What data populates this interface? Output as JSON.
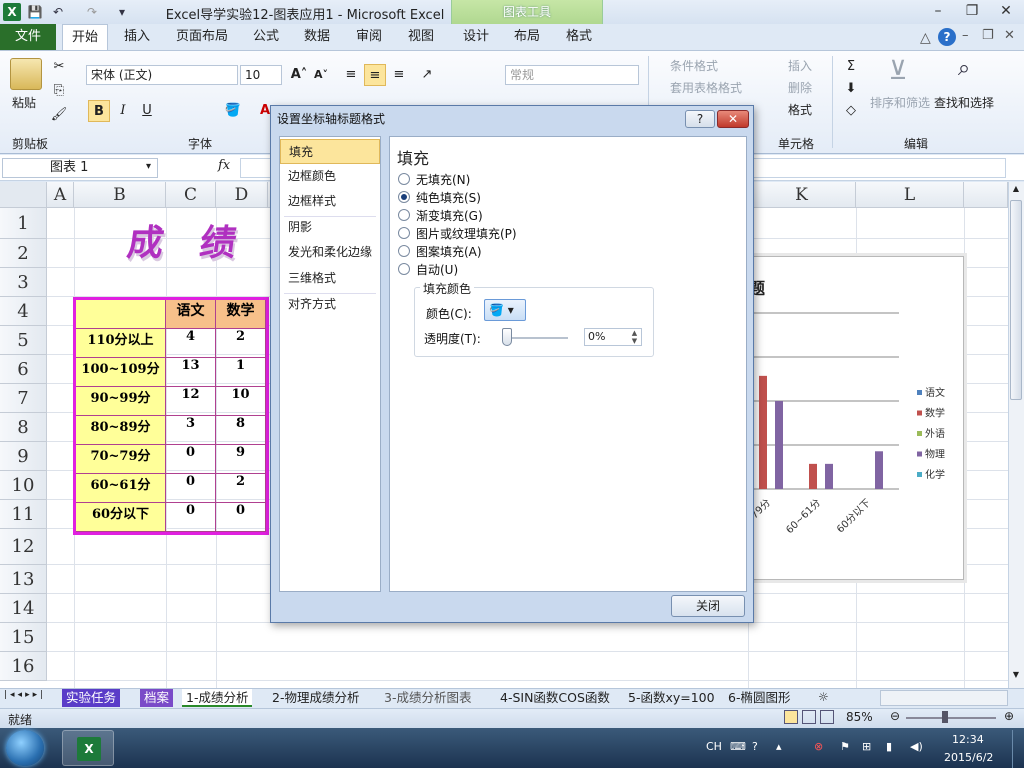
{
  "window": {
    "title": "Excel导学实验12-图表应用1 - Microsoft Excel",
    "context_tab_title": "图表工具"
  },
  "tabs": {
    "file": "文件",
    "home": "开始",
    "insert": "插入",
    "page_layout": "页面布局",
    "formulas": "公式",
    "data": "数据",
    "review": "审阅",
    "view": "视图",
    "design": "设计",
    "layout": "布局",
    "format": "格式"
  },
  "ribbon": {
    "paste": "粘贴",
    "font_name": "宋体 (正文)",
    "font_size": "10",
    "number_format": "常规",
    "conditional_format": "条件格式",
    "table_format": "套用表格格式",
    "insert": "插入",
    "delete": "删除",
    "format": "格式",
    "sort_filter": "排序和筛选",
    "find_select": "查找和选择",
    "groups": {
      "clipboard": "剪贴板",
      "font": "字体",
      "cells": "单元格",
      "editing": "编辑"
    }
  },
  "formula_bar": {
    "name_box": "图表 1",
    "fx": "fx"
  },
  "sheet": {
    "columns": [
      "A",
      "B",
      "C",
      "D",
      "K",
      "L"
    ],
    "rows": [
      "1",
      "2",
      "3",
      "4",
      "5",
      "6",
      "7",
      "8",
      "9",
      "10",
      "11",
      "12",
      "13",
      "14",
      "15",
      "16"
    ],
    "title_art": "成 绩 分",
    "table": {
      "headers": [
        "语文",
        "数学"
      ],
      "rows": [
        {
          "label": "110分以上",
          "v1": "4",
          "v2": "2"
        },
        {
          "label": "100~109分",
          "v1": "13",
          "v2": "1"
        },
        {
          "label": "90~99分",
          "v1": "12",
          "v2": "10"
        },
        {
          "label": "80~89分",
          "v1": "3",
          "v2": "8"
        },
        {
          "label": "70~79分",
          "v1": "0",
          "v2": "9"
        },
        {
          "label": "60~61分",
          "v1": "0",
          "v2": "2"
        },
        {
          "label": "60分以下",
          "v1": "0",
          "v2": "0"
        }
      ]
    }
  },
  "chart_data": {
    "type": "bar",
    "title": "题",
    "legend": [
      "语文",
      "数学",
      "外语",
      "物理",
      "化学"
    ],
    "legend_colors": [
      "#4f81bd",
      "#c0504d",
      "#9bbb59",
      "#8064a2",
      "#4bacc6"
    ],
    "categories": [
      "79分",
      "60~61分",
      "60分以下"
    ],
    "series": [
      {
        "name": "数学",
        "values": [
          9,
          2,
          0
        ]
      },
      {
        "name": "物理",
        "values": [
          7,
          2,
          3
        ]
      }
    ]
  },
  "dialog": {
    "title": "设置坐标轴标题格式",
    "help": "?",
    "close_glyph": "✕",
    "nav": [
      "填充",
      "边框颜色",
      "边框样式",
      "阴影",
      "发光和柔化边缘",
      "三维格式",
      "对齐方式"
    ],
    "panel_title": "填充",
    "options": [
      "无填充(N)",
      "纯色填充(S)",
      "渐变填充(G)",
      "图片或纹理填充(P)",
      "图案填充(A)",
      "自动(U)"
    ],
    "selected": "纯色填充(S)",
    "fill_group": "填充颜色",
    "color_label": "颜色(C):",
    "transparency_label": "透明度(T):",
    "transparency_value": "0%",
    "close_button": "关闭"
  },
  "sheet_tabs": [
    "实验任务",
    "档案",
    "1-成绩分析",
    "2-物理成绩分析",
    "3-成绩分析图表",
    "4-SIN函数COS函数",
    "5-函数xy=100",
    "6-椭圆图形"
  ],
  "status": {
    "ready": "就绪",
    "zoom": "85%"
  },
  "taskbar": {
    "lang": "CH",
    "time": "12:34",
    "date": "2015/6/2"
  }
}
